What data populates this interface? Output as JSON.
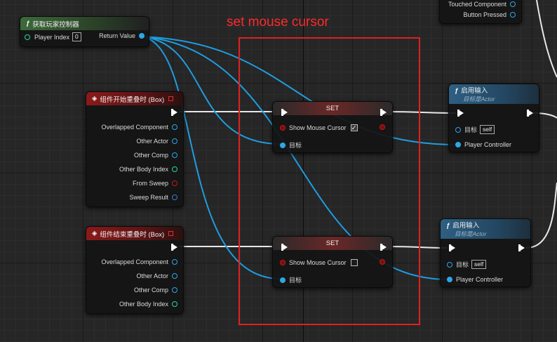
{
  "annotation": {
    "label": "set mouse cursor",
    "color": "#ff2a2a"
  },
  "get_player_controller": {
    "title": "获取玩家控制器",
    "icon": "function-icon",
    "player_index_label": "Player Index",
    "player_index_value": "0",
    "return_value_label": "Return Value"
  },
  "top_partial_node": {
    "touched_component": "Touched Component",
    "button_pressed": "Button Pressed"
  },
  "begin_overlap": {
    "title": "组件开始重叠时 (Box)",
    "pins": [
      "Overlapped Component",
      "Other Actor",
      "Other Comp",
      "Other Body Index",
      "From Sweep",
      "Sweep Result"
    ]
  },
  "end_overlap": {
    "title": "组件结束重叠时 (Box)",
    "pins": [
      "Overlapped Component",
      "Other Actor",
      "Other Comp",
      "Other Body Index"
    ]
  },
  "set_node_1": {
    "title": "SET",
    "show_mouse_cursor": "Show Mouse Cursor",
    "checked": true,
    "target": "目标"
  },
  "set_node_2": {
    "title": "SET",
    "show_mouse_cursor": "Show Mouse Cursor",
    "checked": false,
    "target": "目标"
  },
  "enable_input_1": {
    "title": "启用输入",
    "subtitle": "目标是Actor",
    "target": "目标",
    "target_value": "self",
    "player_controller": "Player Controller"
  },
  "enable_input_2": {
    "title": "启用输入",
    "subtitle": "目标是Actor",
    "target": "目标",
    "target_value": "self",
    "player_controller": "Player Controller"
  }
}
